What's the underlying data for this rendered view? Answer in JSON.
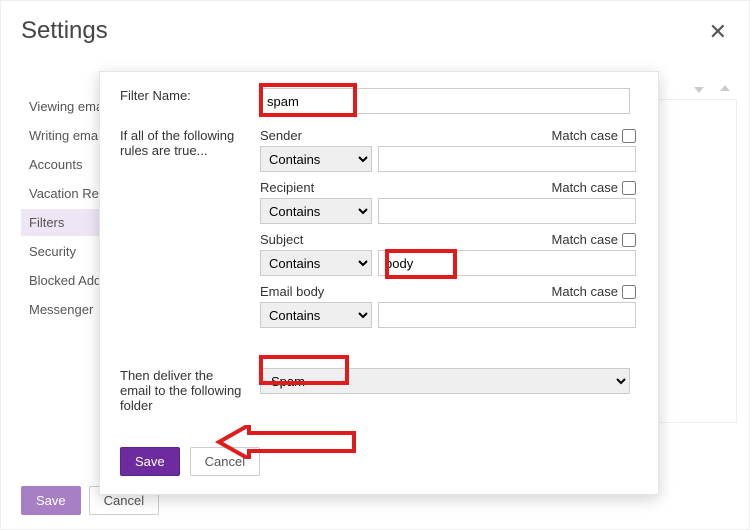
{
  "title": "Settings",
  "sidebar": {
    "items": [
      {
        "label": "Viewing email"
      },
      {
        "label": "Writing email"
      },
      {
        "label": "Accounts"
      },
      {
        "label": "Vacation Response"
      },
      {
        "label": "Filters"
      },
      {
        "label": "Security"
      },
      {
        "label": "Blocked Addresses"
      },
      {
        "label": "Messenger"
      }
    ],
    "active_index": 4
  },
  "bottom": {
    "save": "Save",
    "cancel": "Cancel"
  },
  "dialog": {
    "filter_name_label": "Filter Name:",
    "filter_name": "spam",
    "rules_intro": "If all of the following rules are true...",
    "match_case_label": "Match case",
    "conditions": [
      {
        "field": "Sender",
        "op": "Contains",
        "value": "",
        "match_case": false
      },
      {
        "field": "Recipient",
        "op": "Contains",
        "value": "",
        "match_case": false
      },
      {
        "field": "Subject",
        "op": "Contains",
        "value": "body",
        "match_case": false
      },
      {
        "field": "Email body",
        "op": "Contains",
        "value": "",
        "match_case": false
      }
    ],
    "deliver_label": "Then deliver the email to the following folder",
    "deliver_folder": "Spam",
    "save": "Save",
    "cancel": "Cancel"
  }
}
